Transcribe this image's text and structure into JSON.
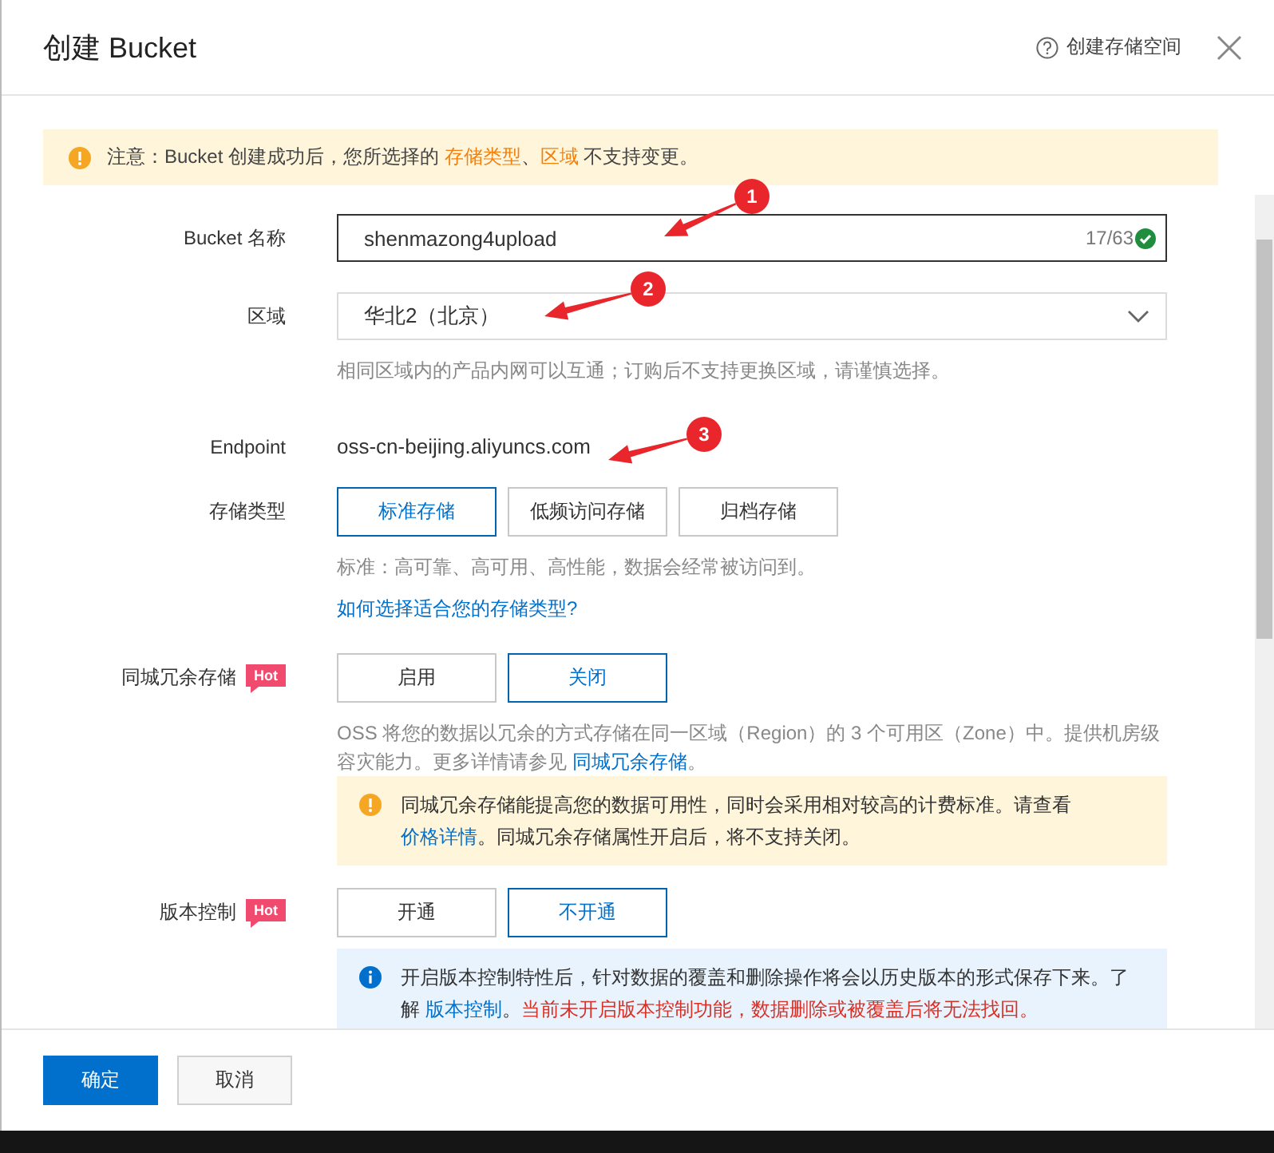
{
  "dialog": {
    "title": "创建 Bucket",
    "help_link": "创建存储空间"
  },
  "notice": [
    {
      "kind": "plain",
      "text": "注意：Bucket 创建成功后，您所选择的 "
    },
    {
      "kind": "highlight",
      "text": "存储类型"
    },
    {
      "kind": "plain",
      "text": "、"
    },
    {
      "kind": "highlight",
      "text": "区域"
    },
    {
      "kind": "plain",
      "text": " 不支持变更。"
    }
  ],
  "form": [
    {
      "kind": "input",
      "label": "Bucket 名称",
      "value": "shenmazong4upload",
      "counter": "17/63",
      "valid": true
    },
    {
      "kind": "select",
      "label": "区域",
      "value": "华北2（北京）",
      "hint": "相同区域内的产品内网可以互通；订购后不支持更换区域，请谨慎选择。"
    },
    {
      "kind": "text",
      "label": "Endpoint",
      "value": "oss-cn-beijing.aliyuncs.com"
    },
    {
      "kind": "options",
      "label": "存储类型",
      "options": [
        {
          "label": "标准存储",
          "selected": true
        },
        {
          "label": "低频访问存储",
          "selected": false
        },
        {
          "label": "归档存储",
          "selected": false
        }
      ],
      "hint": "标准：高可靠、高可用、高性能，数据会经常被访问到。",
      "link": "如何选择适合您的存储类型?"
    },
    {
      "kind": "options",
      "label": "同城冗余存储",
      "badge": "Hot",
      "options": [
        {
          "label": "启用",
          "selected": false
        },
        {
          "label": "关闭",
          "selected": true
        }
      ],
      "description": [
        {
          "kind": "plain",
          "text": "OSS 将您的数据以冗余的方式存储在同一区域（Region）的 3 个可用区（Zone）中。提供机房级容灾能力。更多详情请参见 "
        },
        {
          "kind": "link",
          "text": "同城冗余存储"
        },
        {
          "kind": "plain",
          "text": "。"
        }
      ],
      "alert": {
        "kind": "warning",
        "parts": [
          {
            "kind": "plain",
            "text": "同城冗余存储能提高您的数据可用性，同时会采用相对较高的计费标准。请查看 "
          },
          {
            "kind": "link",
            "text": "价格详情"
          },
          {
            "kind": "plain",
            "text": "。同城冗余存储属性开启后，将不支持关闭。"
          }
        ]
      }
    },
    {
      "kind": "options",
      "label": "版本控制",
      "badge": "Hot",
      "options": [
        {
          "label": "开通",
          "selected": false
        },
        {
          "label": "不开通",
          "selected": true
        }
      ],
      "alert": {
        "kind": "info",
        "parts": [
          {
            "kind": "plain",
            "text": "开启版本控制特性后，针对数据的覆盖和删除操作将会以历史版本的形式保存下来。了解 "
          },
          {
            "kind": "link",
            "text": "版本控制"
          },
          {
            "kind": "plain",
            "text": "。"
          },
          {
            "kind": "danger",
            "text": "当前未开启版本控制功能，数据删除或被覆盖后将无法找回。"
          }
        ]
      }
    }
  ],
  "footer": {
    "buttons": [
      {
        "label": "确定",
        "kind": "primary"
      },
      {
        "label": "取消",
        "kind": "default"
      }
    ]
  },
  "annotations": [
    {
      "number": "1"
    },
    {
      "number": "2"
    },
    {
      "number": "3"
    }
  ]
}
